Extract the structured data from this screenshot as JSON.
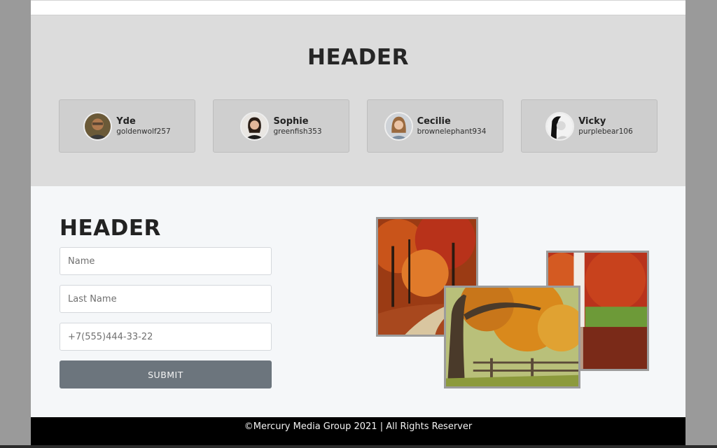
{
  "team": {
    "header": "HEADER",
    "members": [
      {
        "name": "Yde",
        "handle": "goldenwolf257"
      },
      {
        "name": "Sophie",
        "handle": "greenfish353"
      },
      {
        "name": "Cecilie",
        "handle": "brownelephant934"
      },
      {
        "name": "Vicky",
        "handle": "purplebear106"
      }
    ]
  },
  "form": {
    "header": "HEADER",
    "fields": [
      {
        "placeholder": "Name"
      },
      {
        "placeholder": "Last Name"
      },
      {
        "placeholder": "+7(555)444-33-22"
      }
    ],
    "submit_label": "SUBMIT"
  },
  "footer": {
    "text": "©Mercury Media Group 2021 | All Rights Reserver"
  },
  "colors": {
    "team_bg": "#dcdcdc",
    "form_bg": "#f5f7f9",
    "button": "#6c757d",
    "footer_bg": "#000000"
  }
}
